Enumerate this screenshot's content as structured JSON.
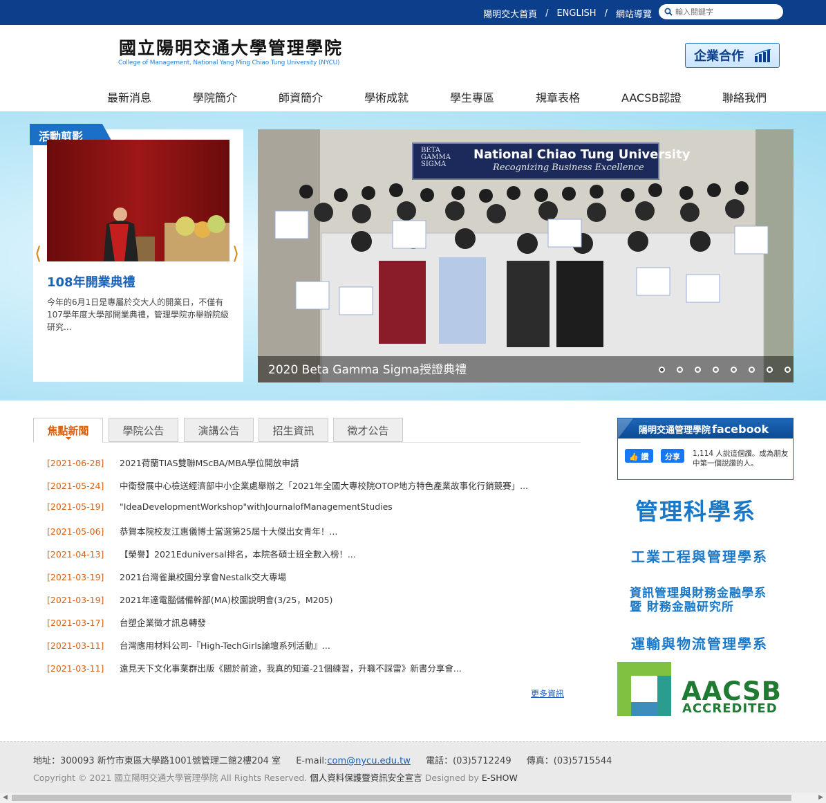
{
  "topbar": {
    "links": [
      "陽明交大首頁",
      "ENGLISH",
      "網站導覽"
    ],
    "separator": "/",
    "search_placeholder": "輸入關鍵字"
  },
  "header": {
    "title": "國立陽明交通大學管理學院",
    "subtitle": "College of Management, National Yang Ming Chiao Tung University (NYCU)",
    "coop_button": "企業合作"
  },
  "nav": [
    "最新消息",
    "學院簡介",
    "師資簡介",
    "學術成就",
    "學生專區",
    "規章表格",
    "AACSB認證",
    "聯絡我們"
  ],
  "activity": {
    "tag": "活動剪影",
    "title": "108年開業典禮",
    "description": "今年的6月1日是專屬於交大人的開業日，不僅有107學年度大學部開業典禮，管理學院亦舉辦院級研究...",
    "prev": "⟨",
    "next": "⟩"
  },
  "slider": {
    "caption": "2020 Beta Gamma Sigma授證典禮",
    "banner_logo": "BETA GAMMA SIGMA",
    "banner_title": "National Chiao Tung University",
    "banner_sub": "Recognizing Business Excellence",
    "total_slides": 8,
    "active_slide": 1
  },
  "news": {
    "tabs": [
      "焦點新聞",
      "學院公告",
      "演講公告",
      "招生資訊",
      "徵才公告"
    ],
    "active_tab": 0,
    "items": [
      {
        "date": "[2021-06-28]",
        "title": "2021荷蘭TIAS雙聯MScBA/MBA學位開放申請"
      },
      {
        "date": "[2021-05-24]",
        "title": "中衛發展中心檢送經濟部中小企業處舉辦之「2021年全國大專校院OTOP地方特色產業故事化行銷競賽」..."
      },
      {
        "date": "[2021-05-19]",
        "title": "\"IdeaDevelopmentWorkshop\"withJournalofManagementStudies"
      },
      {
        "date": "[2021-05-06]",
        "title": "恭賀本院校友江惠儀博士當選第25屆十大傑出女青年！..."
      },
      {
        "date": "[2021-04-13]",
        "title": "【榮譽】2021Eduniversal排名，本院各碩士班全數入榜！..."
      },
      {
        "date": "[2021-03-19]",
        "title": "2021台灣雀巢校園分享會Nestalk交大專場"
      },
      {
        "date": "[2021-03-19]",
        "title": "2021年達電腦儲備幹部(MA)校園說明會(3/25，M205)"
      },
      {
        "date": "[2021-03-17]",
        "title": "台塑企業徵才訊息轉發"
      },
      {
        "date": "[2021-03-11]",
        "title": "台灣應用材料公司-『High-TechGirls論壇系列活動』..."
      },
      {
        "date": "[2021-03-11]",
        "title": "遠見天下文化事業群出版《關於前途，我真的知道-21個練習，升職不踩雷》新書分享會..."
      }
    ],
    "more": "更多資訊"
  },
  "facebook": {
    "header": "陽明交通管理學院",
    "header_brand": "facebook",
    "like_button": "讚",
    "share_button": "分享",
    "text": "1,114 人說這個讚。成為朋友中第一個說讚的人。"
  },
  "departments": [
    "管理科學系",
    "工業工程與管理學系",
    "資訊管理與財務金融學系",
    "暨 財務金融研究所",
    "運輸與物流管理學系"
  ],
  "aacsb": {
    "title": "AACSB",
    "subtitle": "ACCREDITED"
  },
  "footer": {
    "address": "地址：300093 新竹市東區大學路1001號管理二館2樓204 室",
    "email_label": "E-mail:",
    "email": "com@nycu.edu.tw",
    "phone": "電話：(03)5712249",
    "fax": "傳真：(03)5715544",
    "copyright": "Copyright © 2021 國立陽明交通大學管理學院 All Rights Reserved.",
    "privacy": "個人資料保護暨資訊安全宣言",
    "designed_by_label": "Designed by",
    "designer": "E-SHOW"
  },
  "colors": {
    "topbar": "#0b3f8c",
    "accent_orange": "#d85f0e",
    "dept_blue": "#1a78c8",
    "aacsb_green": "#1f7a32"
  }
}
